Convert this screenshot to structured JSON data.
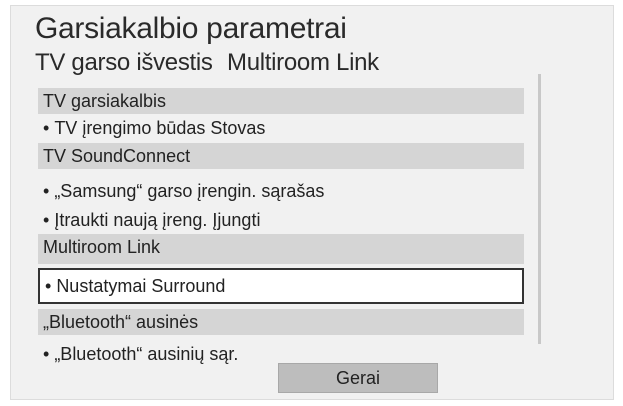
{
  "dialog": {
    "title": "Garsiakalbio parametrai",
    "header_options": [
      {
        "label": "TV garso išvestis"
      },
      {
        "label": "Multiroom Link"
      }
    ]
  },
  "sections": {
    "tv_speaker": {
      "label": "TV garsiakalbis",
      "items": [
        {
          "label": "TV įrengimo būdas",
          "value": "Stovas"
        }
      ]
    },
    "soundconnect": {
      "label": "TV SoundConnect",
      "items": [
        {
          "label": "„Samsung“ garso įrengin. sąrašas"
        },
        {
          "label": "Įtraukti naują įreng.",
          "value": "Įjungti"
        }
      ]
    },
    "multiroom": {
      "label": "Multiroom Link",
      "items": [
        {
          "label": "Nustatymai",
          "value": "Surround",
          "selected": true
        }
      ]
    },
    "bluetooth": {
      "label": "„Bluetooth“ ausinės",
      "items": [
        {
          "label": "„Bluetooth“ ausinių sąr."
        }
      ]
    }
  },
  "bullet": "•",
  "ok_button": {
    "label": "Gerai"
  }
}
